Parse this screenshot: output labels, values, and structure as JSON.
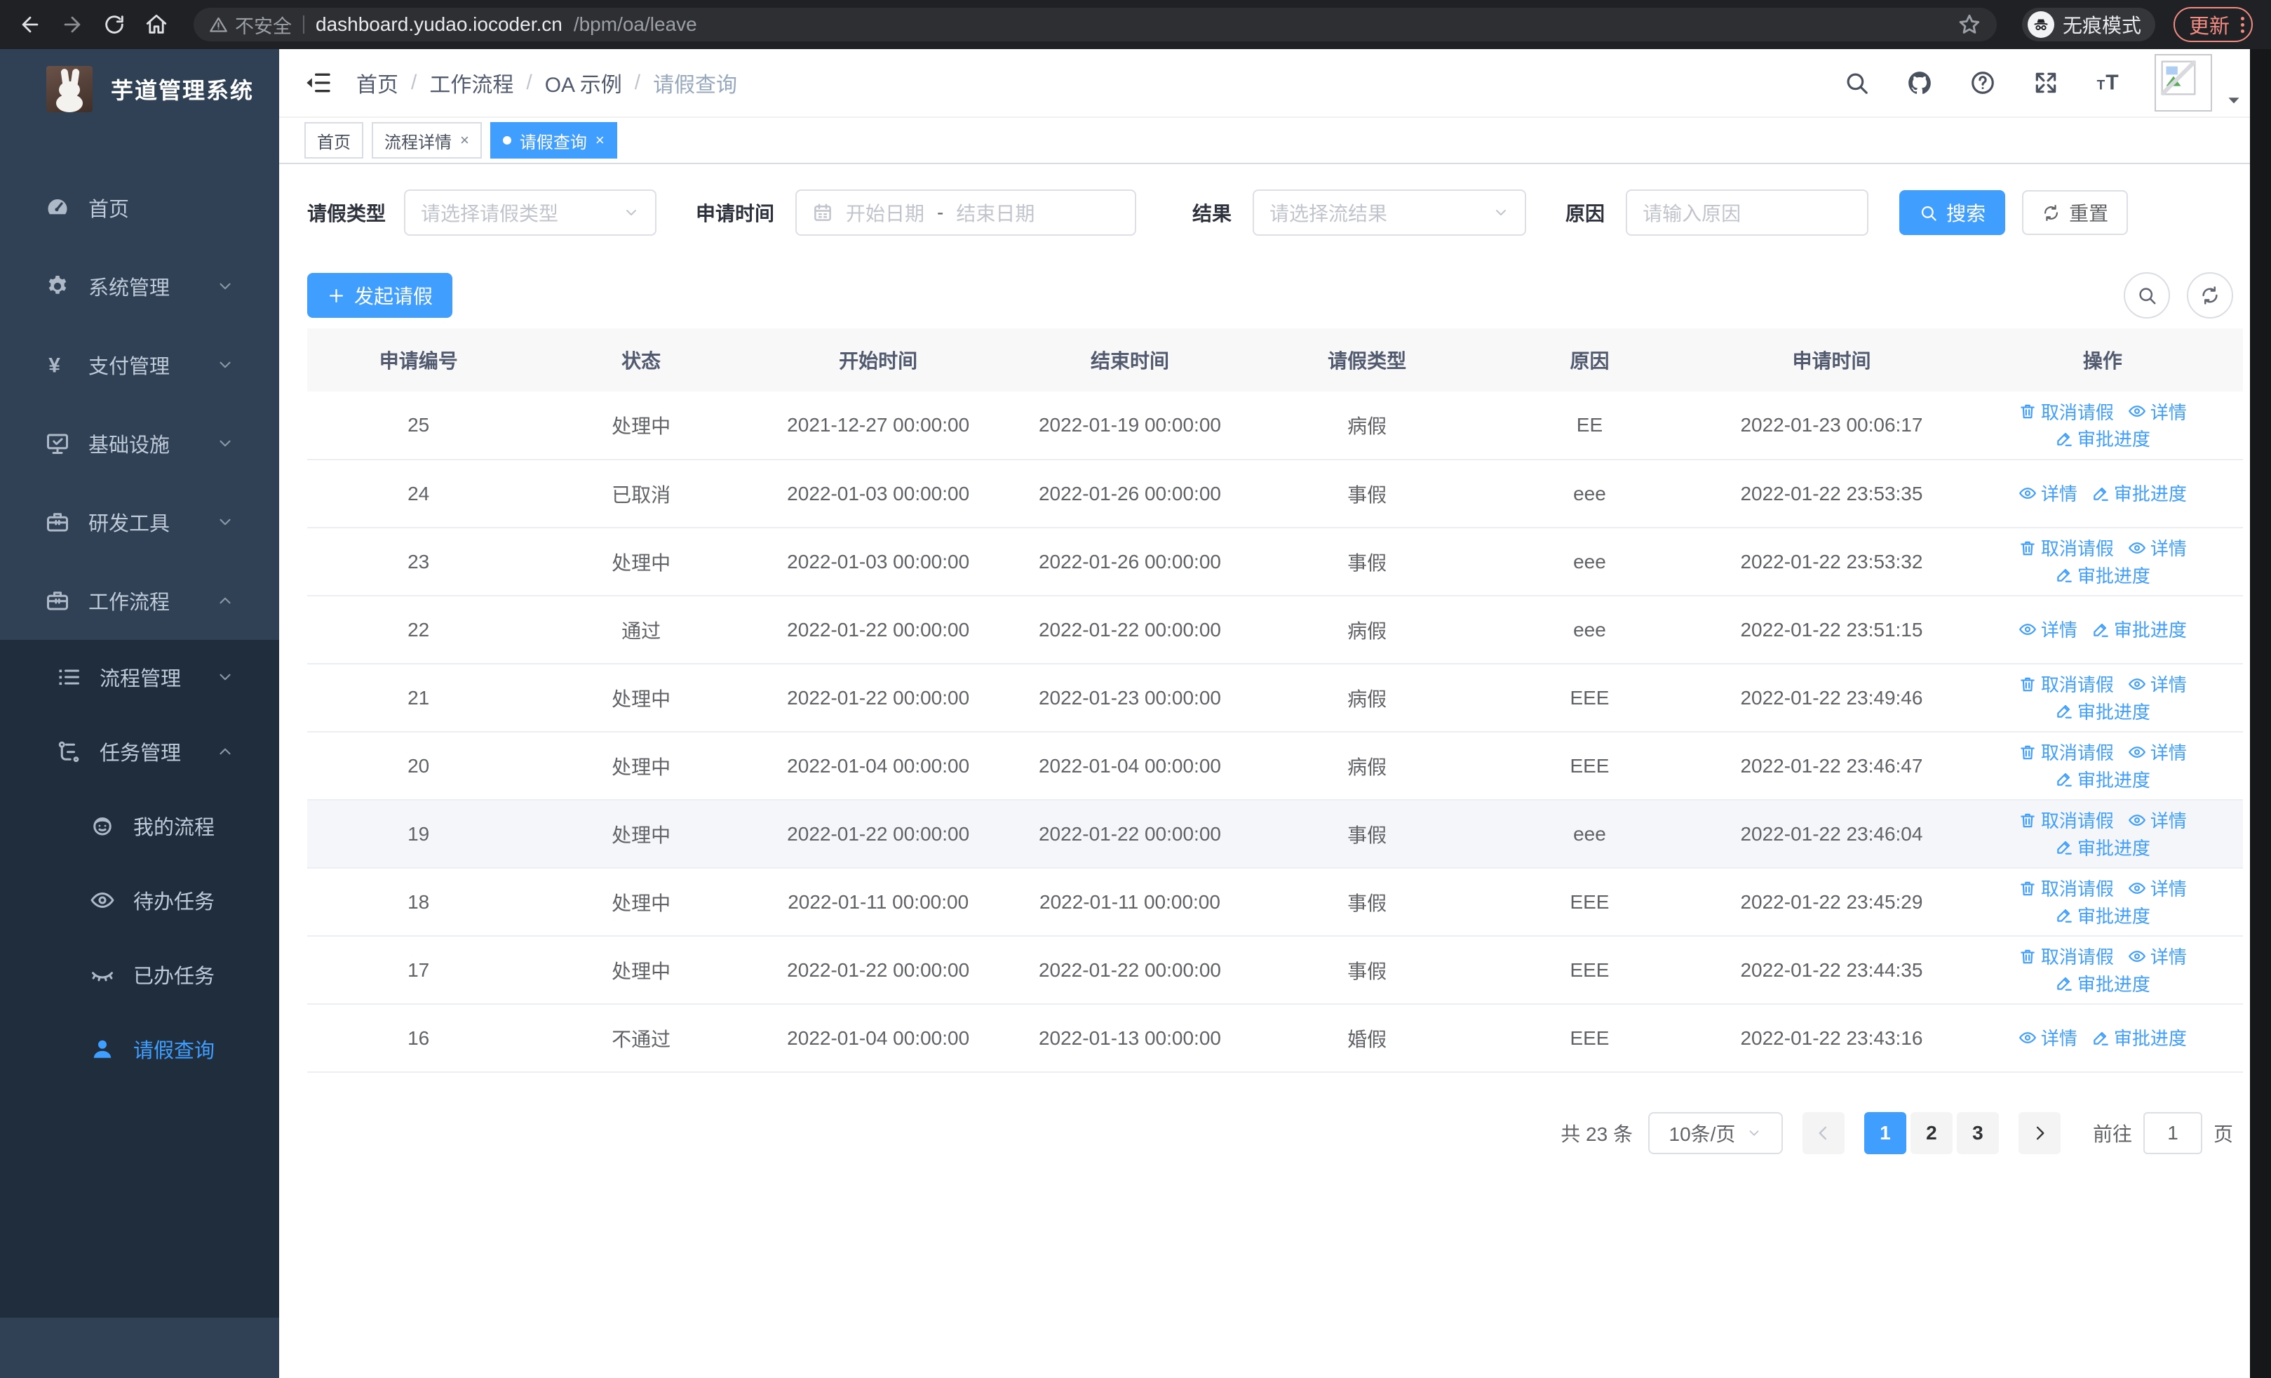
{
  "browser": {
    "security_label": "不安全",
    "url_host": "dashboard.yudao.iocoder.cn",
    "url_path": "/bpm/oa/leave",
    "incognito_label": "无痕模式",
    "update_label": "更新"
  },
  "sidebar": {
    "title": "芋道管理系统",
    "items": [
      {
        "label": "首页",
        "icon": "gauge",
        "level": 1
      },
      {
        "label": "系统管理",
        "icon": "gear",
        "level": 1,
        "arrow": "down"
      },
      {
        "label": "支付管理",
        "icon": "yen",
        "level": 1,
        "arrow": "down"
      },
      {
        "label": "基础设施",
        "icon": "monitor",
        "level": 1,
        "arrow": "down"
      },
      {
        "label": "研发工具",
        "icon": "toolbox",
        "level": 1,
        "arrow": "down"
      },
      {
        "label": "工作流程",
        "icon": "toolbox",
        "level": 1,
        "arrow": "up"
      },
      {
        "label": "流程管理",
        "icon": "list",
        "level": 2,
        "arrow": "down",
        "sub": true
      },
      {
        "label": "任务管理",
        "icon": "tree",
        "level": 2,
        "arrow": "up",
        "sub": true
      },
      {
        "label": "我的流程",
        "icon": "face",
        "level": 3,
        "sub": true
      },
      {
        "label": "待办任务",
        "icon": "eye",
        "level": 3,
        "sub": true
      },
      {
        "label": "已办任务",
        "icon": "eyeclosed",
        "level": 3,
        "sub": true
      },
      {
        "label": "请假查询",
        "icon": "user",
        "level": 3,
        "sub": true,
        "active": true
      }
    ]
  },
  "header": {
    "breadcrumb": [
      "首页",
      "工作流程",
      "OA 示例",
      "请假查询"
    ],
    "separator": "/"
  },
  "tabs": [
    {
      "label": "首页",
      "active": false,
      "closable": false
    },
    {
      "label": "流程详情",
      "active": false,
      "closable": true
    },
    {
      "label": "请假查询",
      "active": true,
      "closable": true
    }
  ],
  "filters": {
    "leave_type_label": "请假类型",
    "leave_type_placeholder": "请选择请假类型",
    "apply_time_label": "申请时间",
    "date_start_placeholder": "开始日期",
    "date_separator": "-",
    "date_end_placeholder": "结束日期",
    "result_label": "结果",
    "result_placeholder": "请选择流结果",
    "reason_label": "原因",
    "reason_placeholder": "请输入原因",
    "search_label": "搜索",
    "reset_label": "重置"
  },
  "toolbar": {
    "create_label": "发起请假"
  },
  "table": {
    "columns": [
      "申请编号",
      "状态",
      "开始时间",
      "结束时间",
      "请假类型",
      "原因",
      "申请时间",
      "操作"
    ],
    "action_labels": {
      "cancel": "取消请假",
      "detail": "详情",
      "progress": "审批进度"
    },
    "rows": [
      {
        "id": "25",
        "status": "处理中",
        "start": "2021-12-27 00:00:00",
        "end": "2022-01-19 00:00:00",
        "type": "病假",
        "reason": "EE",
        "apply": "2022-01-23 00:06:17",
        "cancelable": true,
        "highlight": false
      },
      {
        "id": "24",
        "status": "已取消",
        "start": "2022-01-03 00:00:00",
        "end": "2022-01-26 00:00:00",
        "type": "事假",
        "reason": "eee",
        "apply": "2022-01-22 23:53:35",
        "cancelable": false,
        "highlight": false
      },
      {
        "id": "23",
        "status": "处理中",
        "start": "2022-01-03 00:00:00",
        "end": "2022-01-26 00:00:00",
        "type": "事假",
        "reason": "eee",
        "apply": "2022-01-22 23:53:32",
        "cancelable": true,
        "highlight": false
      },
      {
        "id": "22",
        "status": "通过",
        "start": "2022-01-22 00:00:00",
        "end": "2022-01-22 00:00:00",
        "type": "病假",
        "reason": "eee",
        "apply": "2022-01-22 23:51:15",
        "cancelable": false,
        "highlight": false
      },
      {
        "id": "21",
        "status": "处理中",
        "start": "2022-01-22 00:00:00",
        "end": "2022-01-23 00:00:00",
        "type": "病假",
        "reason": "EEE",
        "apply": "2022-01-22 23:49:46",
        "cancelable": true,
        "highlight": false
      },
      {
        "id": "20",
        "status": "处理中",
        "start": "2022-01-04 00:00:00",
        "end": "2022-01-04 00:00:00",
        "type": "病假",
        "reason": "EEE",
        "apply": "2022-01-22 23:46:47",
        "cancelable": true,
        "highlight": false
      },
      {
        "id": "19",
        "status": "处理中",
        "start": "2022-01-22 00:00:00",
        "end": "2022-01-22 00:00:00",
        "type": "事假",
        "reason": "eee",
        "apply": "2022-01-22 23:46:04",
        "cancelable": true,
        "highlight": true
      },
      {
        "id": "18",
        "status": "处理中",
        "start": "2022-01-11 00:00:00",
        "end": "2022-01-11 00:00:00",
        "type": "事假",
        "reason": "EEE",
        "apply": "2022-01-22 23:45:29",
        "cancelable": true,
        "highlight": false
      },
      {
        "id": "17",
        "status": "处理中",
        "start": "2022-01-22 00:00:00",
        "end": "2022-01-22 00:00:00",
        "type": "事假",
        "reason": "EEE",
        "apply": "2022-01-22 23:44:35",
        "cancelable": true,
        "highlight": false
      },
      {
        "id": "16",
        "status": "不通过",
        "start": "2022-01-04 00:00:00",
        "end": "2022-01-13 00:00:00",
        "type": "婚假",
        "reason": "EEE",
        "apply": "2022-01-22 23:43:16",
        "cancelable": false,
        "highlight": false
      }
    ]
  },
  "pagination": {
    "total_label": "共 23 条",
    "page_size_value": "10条/页",
    "pages": [
      "1",
      "2",
      "3"
    ],
    "active_page": "1",
    "goto_label": "前往",
    "goto_value": "1",
    "page_unit_label": "页"
  },
  "colors": {
    "accent": "#409eff",
    "sidebar_bg": "#304156",
    "submenu_bg": "#1f2d3d",
    "update_red": "#f28b82"
  }
}
